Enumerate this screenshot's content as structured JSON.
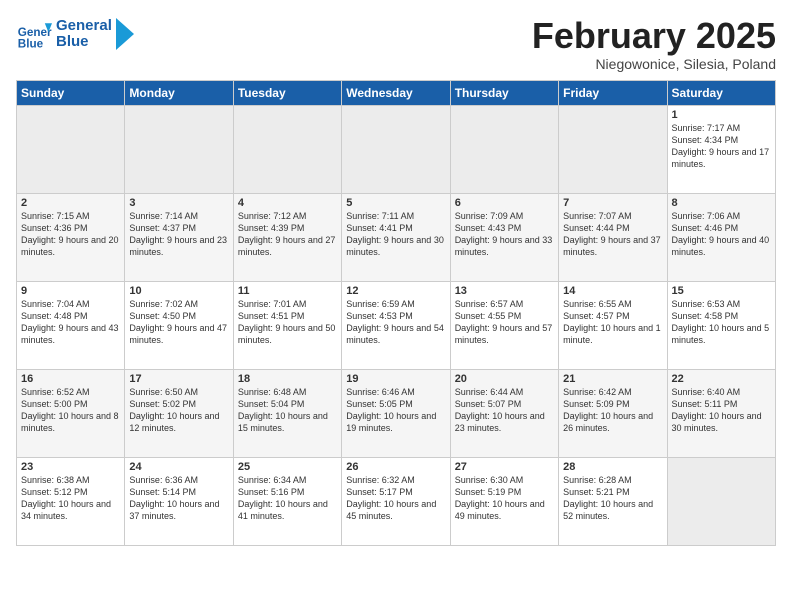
{
  "header": {
    "logo_line1": "General",
    "logo_line2": "Blue",
    "title": "February 2025",
    "subtitle": "Niegowonice, Silesia, Poland"
  },
  "weekdays": [
    "Sunday",
    "Monday",
    "Tuesday",
    "Wednesday",
    "Thursday",
    "Friday",
    "Saturday"
  ],
  "weeks": [
    [
      {
        "day": "",
        "info": ""
      },
      {
        "day": "",
        "info": ""
      },
      {
        "day": "",
        "info": ""
      },
      {
        "day": "",
        "info": ""
      },
      {
        "day": "",
        "info": ""
      },
      {
        "day": "",
        "info": ""
      },
      {
        "day": "1",
        "info": "Sunrise: 7:17 AM\nSunset: 4:34 PM\nDaylight: 9 hours and 17 minutes."
      }
    ],
    [
      {
        "day": "2",
        "info": "Sunrise: 7:15 AM\nSunset: 4:36 PM\nDaylight: 9 hours and 20 minutes."
      },
      {
        "day": "3",
        "info": "Sunrise: 7:14 AM\nSunset: 4:37 PM\nDaylight: 9 hours and 23 minutes."
      },
      {
        "day": "4",
        "info": "Sunrise: 7:12 AM\nSunset: 4:39 PM\nDaylight: 9 hours and 27 minutes."
      },
      {
        "day": "5",
        "info": "Sunrise: 7:11 AM\nSunset: 4:41 PM\nDaylight: 9 hours and 30 minutes."
      },
      {
        "day": "6",
        "info": "Sunrise: 7:09 AM\nSunset: 4:43 PM\nDaylight: 9 hours and 33 minutes."
      },
      {
        "day": "7",
        "info": "Sunrise: 7:07 AM\nSunset: 4:44 PM\nDaylight: 9 hours and 37 minutes."
      },
      {
        "day": "8",
        "info": "Sunrise: 7:06 AM\nSunset: 4:46 PM\nDaylight: 9 hours and 40 minutes."
      }
    ],
    [
      {
        "day": "9",
        "info": "Sunrise: 7:04 AM\nSunset: 4:48 PM\nDaylight: 9 hours and 43 minutes."
      },
      {
        "day": "10",
        "info": "Sunrise: 7:02 AM\nSunset: 4:50 PM\nDaylight: 9 hours and 47 minutes."
      },
      {
        "day": "11",
        "info": "Sunrise: 7:01 AM\nSunset: 4:51 PM\nDaylight: 9 hours and 50 minutes."
      },
      {
        "day": "12",
        "info": "Sunrise: 6:59 AM\nSunset: 4:53 PM\nDaylight: 9 hours and 54 minutes."
      },
      {
        "day": "13",
        "info": "Sunrise: 6:57 AM\nSunset: 4:55 PM\nDaylight: 9 hours and 57 minutes."
      },
      {
        "day": "14",
        "info": "Sunrise: 6:55 AM\nSunset: 4:57 PM\nDaylight: 10 hours and 1 minute."
      },
      {
        "day": "15",
        "info": "Sunrise: 6:53 AM\nSunset: 4:58 PM\nDaylight: 10 hours and 5 minutes."
      }
    ],
    [
      {
        "day": "16",
        "info": "Sunrise: 6:52 AM\nSunset: 5:00 PM\nDaylight: 10 hours and 8 minutes."
      },
      {
        "day": "17",
        "info": "Sunrise: 6:50 AM\nSunset: 5:02 PM\nDaylight: 10 hours and 12 minutes."
      },
      {
        "day": "18",
        "info": "Sunrise: 6:48 AM\nSunset: 5:04 PM\nDaylight: 10 hours and 15 minutes."
      },
      {
        "day": "19",
        "info": "Sunrise: 6:46 AM\nSunset: 5:05 PM\nDaylight: 10 hours and 19 minutes."
      },
      {
        "day": "20",
        "info": "Sunrise: 6:44 AM\nSunset: 5:07 PM\nDaylight: 10 hours and 23 minutes."
      },
      {
        "day": "21",
        "info": "Sunrise: 6:42 AM\nSunset: 5:09 PM\nDaylight: 10 hours and 26 minutes."
      },
      {
        "day": "22",
        "info": "Sunrise: 6:40 AM\nSunset: 5:11 PM\nDaylight: 10 hours and 30 minutes."
      }
    ],
    [
      {
        "day": "23",
        "info": "Sunrise: 6:38 AM\nSunset: 5:12 PM\nDaylight: 10 hours and 34 minutes."
      },
      {
        "day": "24",
        "info": "Sunrise: 6:36 AM\nSunset: 5:14 PM\nDaylight: 10 hours and 37 minutes."
      },
      {
        "day": "25",
        "info": "Sunrise: 6:34 AM\nSunset: 5:16 PM\nDaylight: 10 hours and 41 minutes."
      },
      {
        "day": "26",
        "info": "Sunrise: 6:32 AM\nSunset: 5:17 PM\nDaylight: 10 hours and 45 minutes."
      },
      {
        "day": "27",
        "info": "Sunrise: 6:30 AM\nSunset: 5:19 PM\nDaylight: 10 hours and 49 minutes."
      },
      {
        "day": "28",
        "info": "Sunrise: 6:28 AM\nSunset: 5:21 PM\nDaylight: 10 hours and 52 minutes."
      },
      {
        "day": "",
        "info": ""
      }
    ]
  ]
}
